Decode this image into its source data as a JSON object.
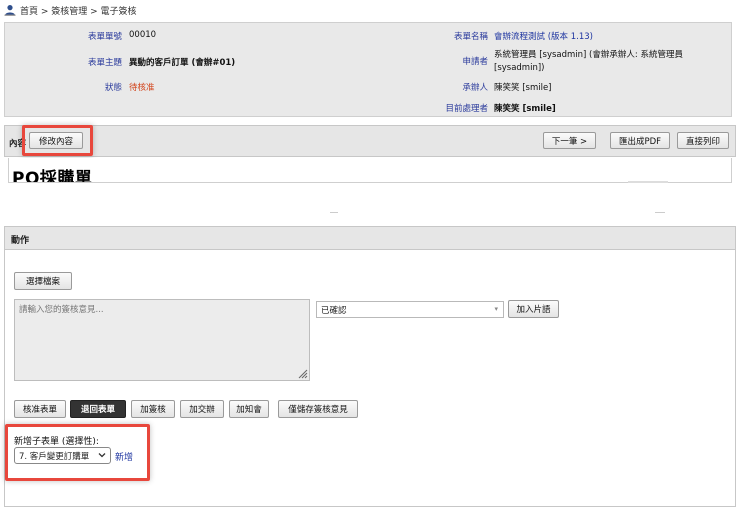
{
  "breadcrumb": "首頁 > 簽核管理 > 電子簽核",
  "info": {
    "form_no_label": "表單單號",
    "form_no": "00010",
    "form_name_label": "表單名稱",
    "form_name": "會辦流程測試 (版本 1.13)",
    "subject_label": "表單主題",
    "subject": "異動的客戶訂單 (會辦#01)",
    "applicant_label": "申請者",
    "applicant": "系統管理員 [sysadmin] (會辦承辦人: 系統管理員 [sysadmin])",
    "status_label": "狀態",
    "status": "待核准",
    "handler_label": "承辦人",
    "handler": "陳笑笑 [smile]",
    "current_label": "目前處理者",
    "current": "陳笑笑 [smile]"
  },
  "content_bar": {
    "label": "內容",
    "edit_button": "修改內容",
    "next_button": "下一筆 >",
    "export_pdf_button": "匯出成PDF",
    "print_button": "直接列印"
  },
  "document": {
    "title": "PO採購單"
  },
  "actions": {
    "header": "動作",
    "choose_file_button": "選擇檔案",
    "comment_placeholder": "請輸入您的簽核意見...",
    "phrase_select": "已確認",
    "add_phrase_button": "加入片語",
    "approve_button": "核准表單",
    "return_button": "退回表單",
    "add_signer_button": "加簽核",
    "add_handover_button": "加交辦",
    "add_notify_button": "加知會",
    "save_comment_button": "僅儲存簽核意見"
  },
  "sub_form": {
    "label": "新增子表單 (選擇性):",
    "selected": "7. 客戶變更訂購單",
    "add_link": "新增"
  },
  "colors": {
    "label_blue": "#2a3a9c",
    "status_red": "#d2441b",
    "highlight_red": "#e8473c"
  }
}
